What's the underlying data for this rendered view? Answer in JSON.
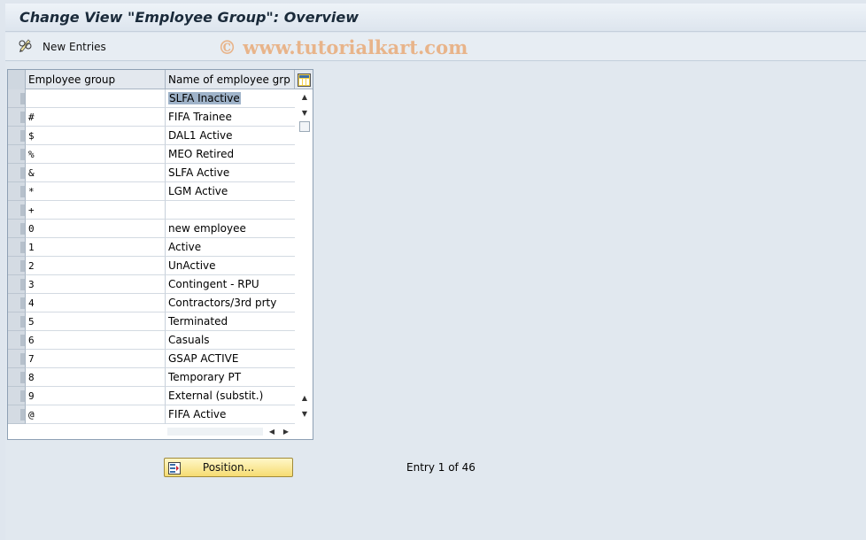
{
  "window": {
    "title": "Change View \"Employee Group\": Overview"
  },
  "toolbar": {
    "new_entries_label": "New Entries"
  },
  "watermark": "© www.tutorialkart.com",
  "table": {
    "columns": [
      "Employee group",
      "Name of employee grp"
    ],
    "rows": [
      {
        "group": "",
        "name": "SLFA Inactive"
      },
      {
        "group": "#",
        "name": "FIFA Trainee"
      },
      {
        "group": "$",
        "name": "DAL1 Active"
      },
      {
        "group": "%",
        "name": "MEO Retired"
      },
      {
        "group": "&",
        "name": "SLFA Active"
      },
      {
        "group": "*",
        "name": "LGM Active"
      },
      {
        "group": "+",
        "name": ""
      },
      {
        "group": "0",
        "name": "new employee"
      },
      {
        "group": "1",
        "name": "Active"
      },
      {
        "group": "2",
        "name": "UnActive"
      },
      {
        "group": "3",
        "name": "Contingent - RPU"
      },
      {
        "group": "4",
        "name": "Contractors/3rd prty"
      },
      {
        "group": "5",
        "name": "Terminated"
      },
      {
        "group": "6",
        "name": "Casuals"
      },
      {
        "group": "7",
        "name": "GSAP ACTIVE"
      },
      {
        "group": "8",
        "name": "Temporary PT"
      },
      {
        "group": "9",
        "name": "External (substit.)"
      },
      {
        "group": "@",
        "name": "FIFA Active"
      }
    ]
  },
  "position_button": {
    "label": "Position..."
  },
  "entry_status": "Entry 1 of 46",
  "icons": {
    "new_entries": "pencil-glasses-icon",
    "table_settings": "column-config-icon",
    "position": "position-list-icon"
  }
}
